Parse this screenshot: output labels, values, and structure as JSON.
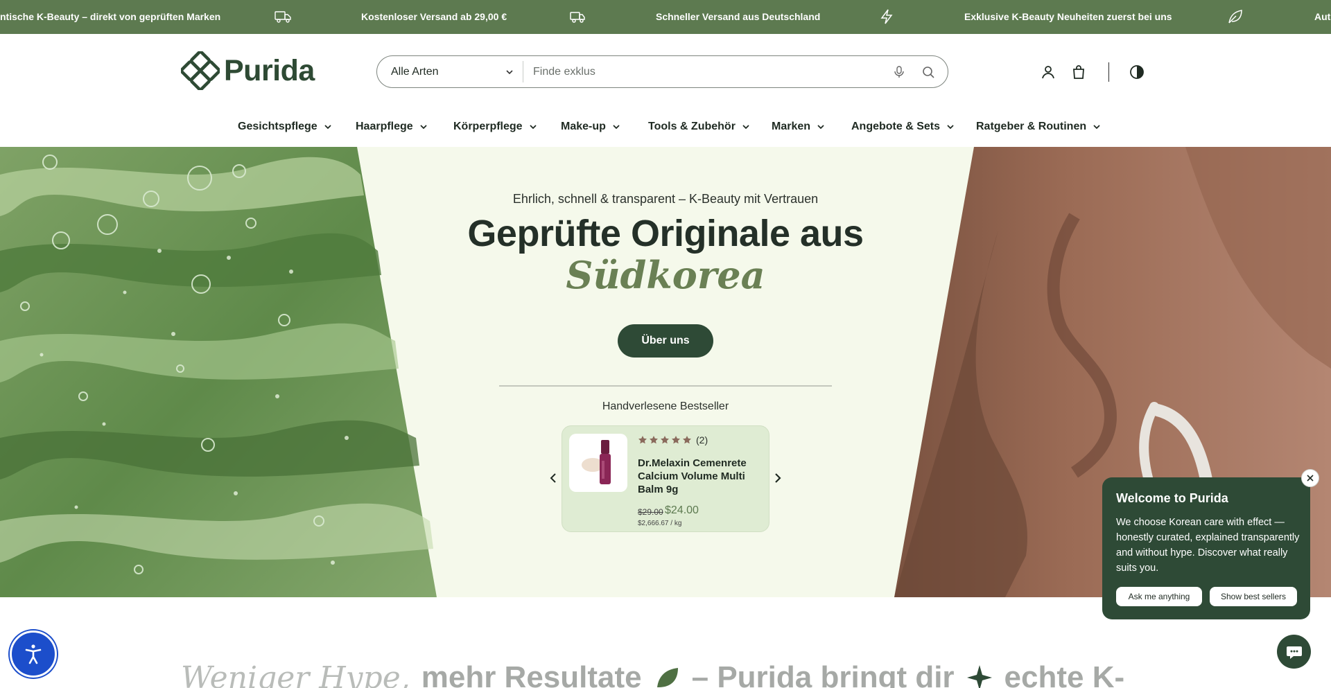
{
  "announcement": {
    "items": [
      {
        "text": "Authentische K-Beauty – direkt von geprüften Marken",
        "visible": "ntische K-Beauty – direkt von geprüften Marken"
      },
      {
        "icon": "free-shipping-truck-icon"
      },
      {
        "text": "Kostenloser Versand ab 29,00 €"
      },
      {
        "icon": "fast-truck-icon"
      },
      {
        "text": "Schneller Versand aus Deutschland"
      },
      {
        "icon": "lightning-icon"
      },
      {
        "text": "Exklusive K-Beauty Neuheiten zuerst bei uns"
      },
      {
        "icon": "leaf-icon"
      },
      {
        "text": "Auth"
      }
    ]
  },
  "header": {
    "logo_text": "Purida",
    "search": {
      "category": "Alle Arten",
      "placeholder": "Finde exklus"
    },
    "icons": [
      "account-icon",
      "cart-icon",
      "theme-toggle-icon"
    ]
  },
  "nav": {
    "items": [
      {
        "label": "Gesichtspflege"
      },
      {
        "label": "Haarpflege"
      },
      {
        "label": "Körperpflege"
      },
      {
        "label": "Make-up"
      },
      {
        "label": "Tools & Zubehör"
      },
      {
        "label": "Marken"
      },
      {
        "label": "Angebote & Sets"
      },
      {
        "label": "Ratgeber & Routinen"
      }
    ]
  },
  "hero": {
    "kicker": "Ehrlich, schnell & transparent – K-Beauty mit Vertrauen",
    "title": "Geprüfte Originale aus",
    "accent": "Südkorea",
    "button": "Über uns",
    "bestseller_label": "Handverlesene Bestseller",
    "product": {
      "rating_stars": 5,
      "rating_count": "(2)",
      "name": "Dr.Melaxin Cemenrete Calcium Volume Multi Balm 9g",
      "price_old": "$29.00",
      "price_new": "$24.00",
      "price_unit": "$2,666.67 / kg"
    }
  },
  "popup": {
    "title": "Welcome to Purida",
    "body": "We choose Korean care with effect — honestly curated, explained transparently and without hype. Discover what really suits you.",
    "btn_ask": "Ask me anything",
    "btn_best": "Show best sellers"
  },
  "bottom": {
    "italic": "Weniger Hype,",
    "text1": "mehr Resultate",
    "text2": "– Purida bringt dir",
    "text3": "echte K-"
  },
  "colors": {
    "brand_green": "#5d7a50",
    "dark_green": "#2e4a36",
    "hero_bg": "#f5f9eb",
    "a11y_blue": "#1c4ecb"
  }
}
